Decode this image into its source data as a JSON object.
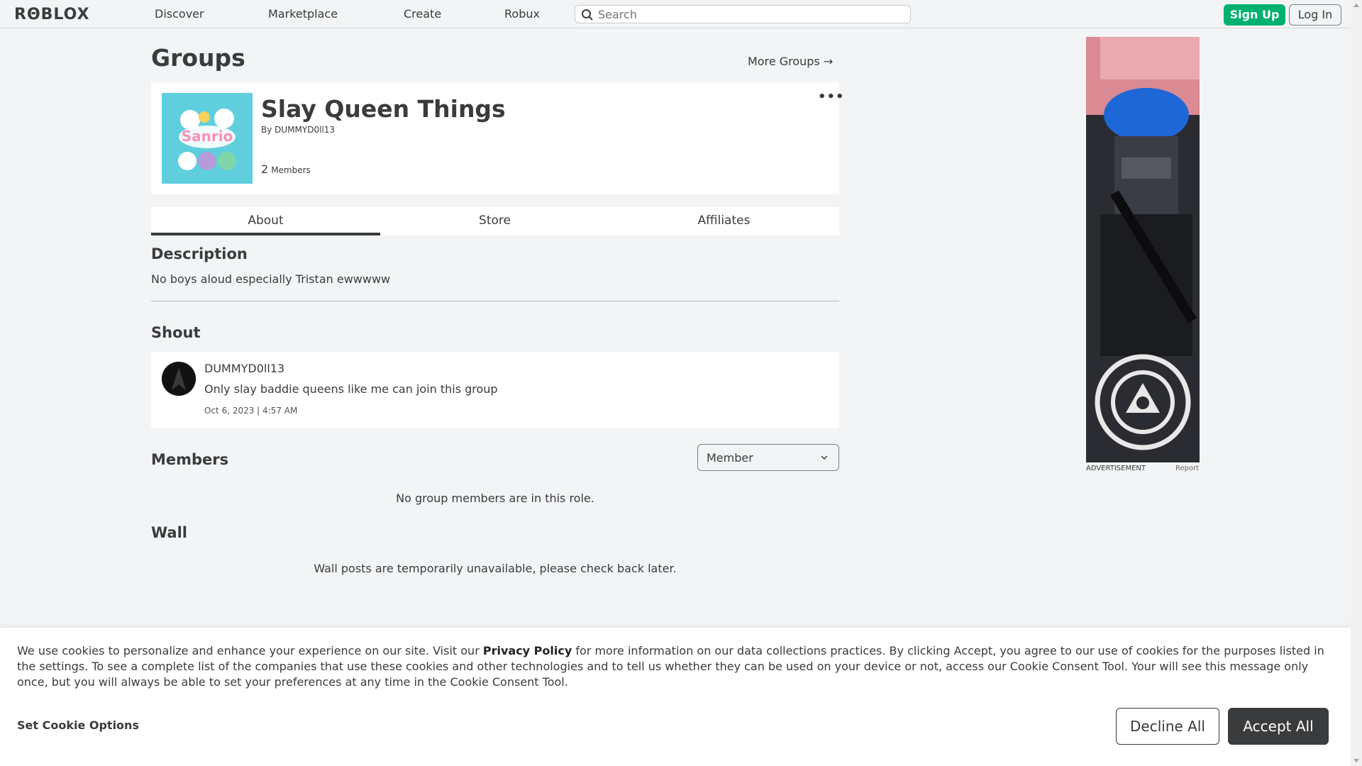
{
  "nav": {
    "logo": "RΘBLOX",
    "links": [
      "Discover",
      "Marketplace",
      "Create",
      "Robux"
    ],
    "search_placeholder": "Search",
    "signup": "Sign Up",
    "login": "Log In"
  },
  "page": {
    "title": "Groups",
    "more_groups": "More Groups →"
  },
  "group": {
    "name": "Slay Queen Things",
    "by_label": "By",
    "owner": "DUMMYD0ll13",
    "member_count": "2",
    "members_label": "Members",
    "menu": "•••",
    "thumb_text": "Sanrio"
  },
  "tabs": [
    "About",
    "Store",
    "Affiliates"
  ],
  "description": {
    "heading": "Description",
    "text": "No boys aloud especially Tristan ewwwww"
  },
  "shout": {
    "heading": "Shout",
    "user": "DUMMYD0ll13",
    "text": "Only slay baddie queens like me can join this group",
    "date": "Oct 6, 2023 | 4:57 AM"
  },
  "members": {
    "heading": "Members",
    "role": "Member",
    "empty": "No group members are in this role."
  },
  "wall": {
    "heading": "Wall",
    "message": "Wall posts are temporarily unavailable, please check back later."
  },
  "ad": {
    "label": "ADVERTISEMENT",
    "report": "Report"
  },
  "cookie": {
    "text_before": "We use cookies to personalize and enhance your experience on our site. Visit our ",
    "link": "Privacy Policy",
    "text_after": " for more information on our data collections practices. By clicking Accept, you agree to our use of cookies for the purposes listed in the settings. To see a complete list of the companies that use these cookies and other technologies and to tell us whether they can be used on your device or not, access our Cookie Consent Tool. Your will see this message only once, but you will always be able to set your preferences at any time in the Cookie Consent Tool.",
    "set_options": "Set Cookie Options",
    "decline": "Decline All",
    "accept": "Accept All"
  },
  "colors": {
    "signup_bg": "#00b06f",
    "page_bg": "#f2f4f5",
    "text": "#393b3d",
    "accept_bg": "#393b3d"
  }
}
